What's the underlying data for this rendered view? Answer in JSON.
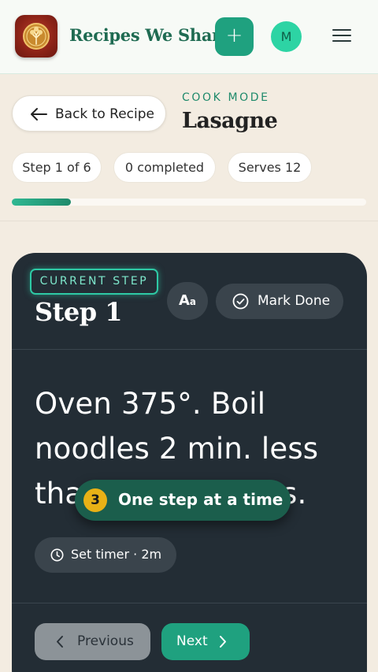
{
  "header": {
    "app_title": "Recipes We Share",
    "add_label": "+",
    "avatar_initial": "M"
  },
  "nav": {
    "back_label": "Back to Recipe"
  },
  "recipe": {
    "mode_label": "COOK MODE",
    "name": "Lasagne"
  },
  "chips": {
    "step": "Step 1 of 6",
    "completed": "0 completed",
    "serves": "Serves 12"
  },
  "progress": {
    "fraction": 0.1667
  },
  "card": {
    "badge": "CURRENT STEP",
    "title": "Step 1",
    "text_size_big": "A",
    "text_size_small": "a",
    "mark_done_label": "Mark Done",
    "instruction": "Oven 375°. Boil noodles 2 min. less than the box says.",
    "timer_label": "Set timer · 2m",
    "previous_label": "Previous",
    "next_label": "Next"
  },
  "toast": {
    "number": "3",
    "message": "One step at a time"
  },
  "colors": {
    "accent": "#1fa17f",
    "card_bg": "#232d35",
    "page_bg": "#f3ece1",
    "badge": "#e8b116"
  },
  "icons": [
    "logo-tree-icon",
    "plus-icon",
    "hamburger-menu-icon",
    "arrow-left-icon",
    "check-circle-icon",
    "clock-icon",
    "chevron-left-icon",
    "chevron-right-icon"
  ]
}
